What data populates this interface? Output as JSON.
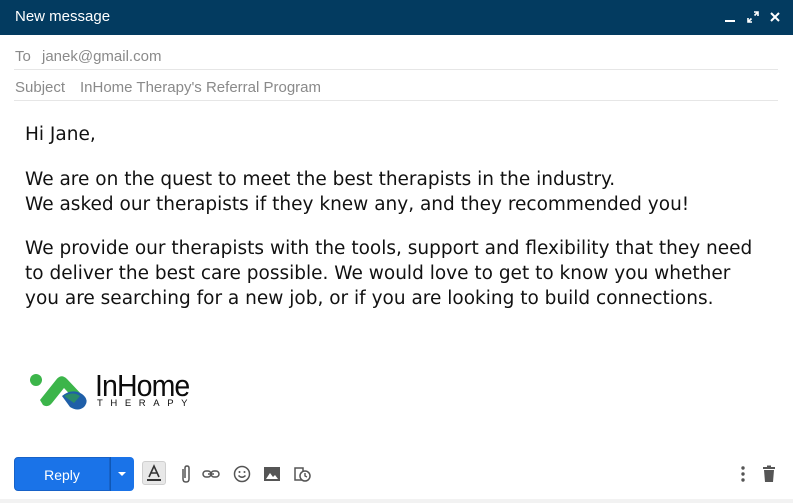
{
  "window": {
    "title": "New message"
  },
  "fields": {
    "to_label": "To",
    "to_value": "janek@gmail.com",
    "subject_label": "Subject",
    "subject_value": "InHome Therapy's Referral Program"
  },
  "body": {
    "greeting": "Hi Jane,",
    "para1_line1": "We are on the quest to meet the best therapists in the industry.",
    "para1_line2": "We asked our therapists if they knew any, and they recommended you!",
    "para2_line1": "We provide our therapists with the tools, support and flexibility that they need",
    "para2_line2": "to deliver the best care possible. We would love to get to know you whether",
    "para2_line3": "you are searching for a new job, or if you are looking to build connections."
  },
  "signature": {
    "logo_word": "InHome",
    "logo_sub": "THERAPY"
  },
  "toolbar": {
    "reply_label": "Reply"
  },
  "colors": {
    "titlebar": "#033b60",
    "reply_button": "#1a73e8",
    "logo_green": "#3cb54a",
    "logo_blue": "#1f5fa8"
  },
  "icons": [
    "minimize-icon",
    "expand-icon",
    "close-icon",
    "chevron-down-icon",
    "text-format-icon",
    "attach-icon",
    "link-icon",
    "emoji-icon",
    "image-icon",
    "confidential-icon",
    "more-options-icon",
    "trash-icon"
  ]
}
